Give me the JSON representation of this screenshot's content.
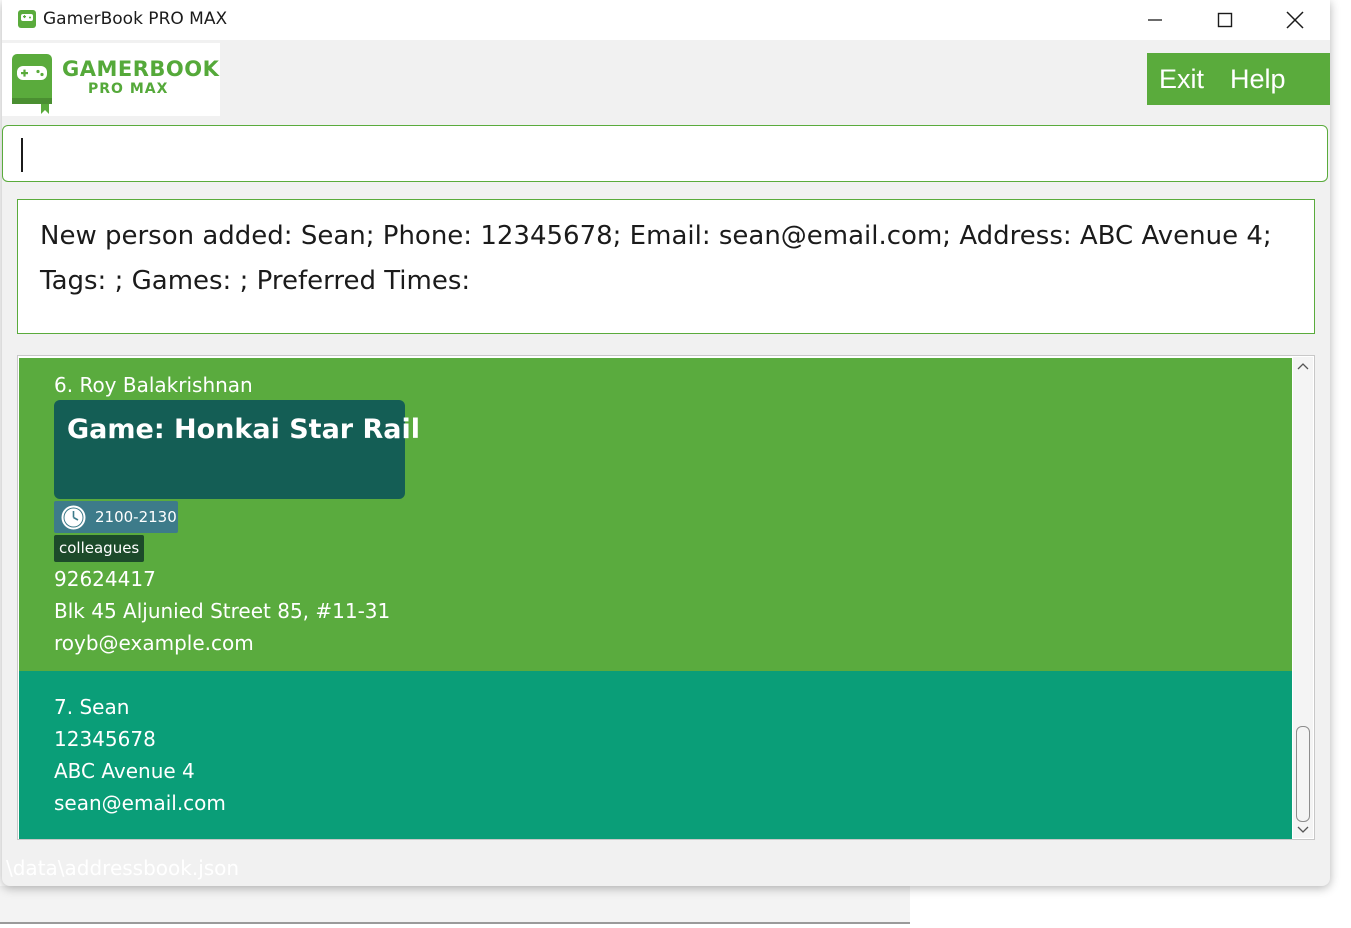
{
  "window": {
    "title": "GamerBook PRO MAX",
    "logo_line1": "GAMERBOOK",
    "logo_line2": "PRO MAX",
    "accent": "#5aab3c"
  },
  "menu": {
    "exit_label": "Exit",
    "help_label": "Help"
  },
  "command_box": {
    "value": ""
  },
  "result_display": {
    "text": "New person added: Sean; Phone: 12345678; Email: sean@email.com; Address: ABC Avenue 4; Tags: ; Games: ; Preferred Times:"
  },
  "person_list": [
    {
      "index_name": "6. Roy Balakrishnan",
      "game": "Game: Honkai Star Rail",
      "preferred_time": "2100-2130",
      "tag": "colleagues",
      "phone": "92624417",
      "address": "Blk 45 Aljunied Street 85, #11-31",
      "email": "royb@example.com",
      "color": "#5aab3e"
    },
    {
      "index_name": "7. Sean",
      "phone": "12345678",
      "address": "ABC Avenue 4",
      "email": "sean@email.com",
      "color": "#0a9e78"
    }
  ],
  "status_bar": {
    "path": "\\data\\addressbook.json"
  },
  "icons": {
    "app": "gamepad-book-icon",
    "clock": "clock-icon"
  }
}
